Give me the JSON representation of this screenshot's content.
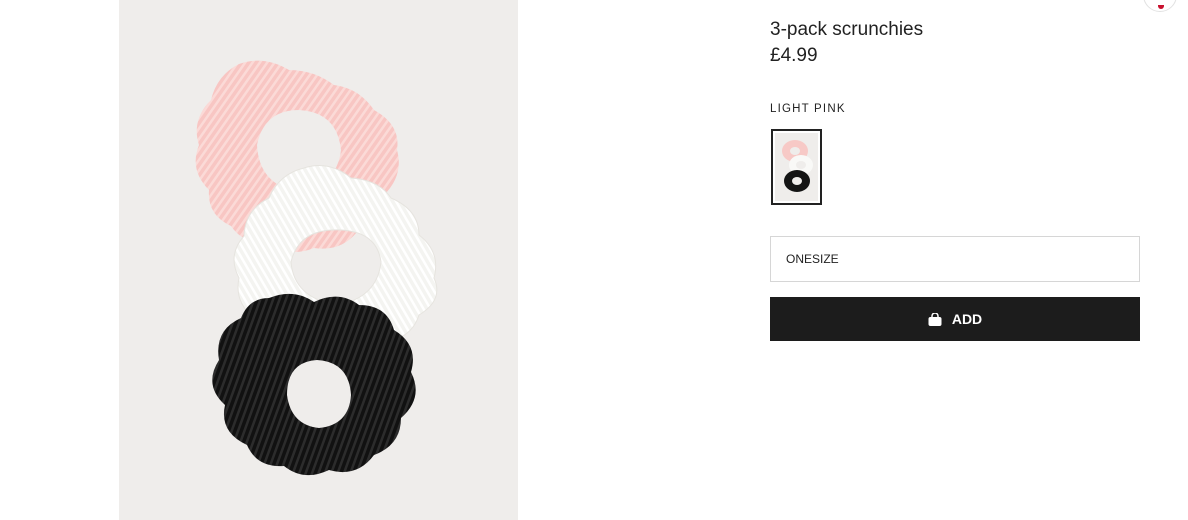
{
  "product": {
    "title": "3-pack scrunchies",
    "price": "£4.99",
    "color_name": "LIGHT PINK",
    "size_value": "ONESIZE",
    "add_label": "ADD"
  },
  "colors": {
    "pink": "#f9c9c6",
    "white": "#f8f8f6",
    "black": "#151515",
    "button": "#1c1c1c",
    "background": "#efedeb"
  },
  "icons": {
    "add_button_icon": "shopping-bag-icon",
    "wishlist": "heart-icon"
  }
}
